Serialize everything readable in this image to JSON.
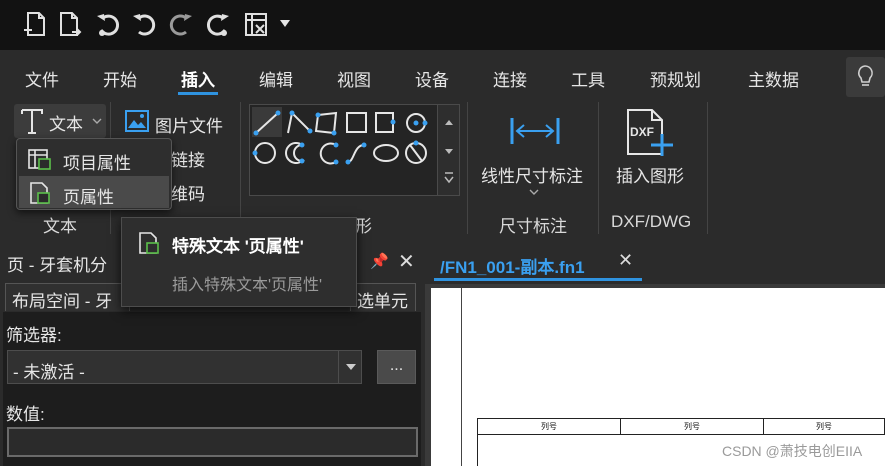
{
  "quick_access": {
    "icons": [
      "new-file-icon",
      "new-file-from-template-icon",
      "undo-history-icon",
      "undo-icon",
      "redo-icon",
      "redo-history-icon",
      "close-project-icon"
    ]
  },
  "ribbon_tabs": [
    "文件",
    "开始",
    "插入",
    "编辑",
    "视图",
    "设备",
    "连接",
    "工具",
    "预规划",
    "主数据"
  ],
  "active_tab": "插入",
  "ribbon": {
    "text_button": "文本",
    "picture_file": "图片文件",
    "hyperlink": "链接",
    "qrcode": "维码",
    "graphics_group_partial": "图形",
    "graphics_group_obscured": "图片",
    "linear_dimension": "线性尺寸标注",
    "insert_graphic": "插入图形",
    "dxf_badge": "DXF",
    "groups": {
      "text": "文本",
      "dimension": "尺寸标注",
      "dxf": "DXF/DWG"
    }
  },
  "text_menu": {
    "items": [
      "项目属性",
      "页属性"
    ]
  },
  "tooltip": {
    "title": "特殊文本 '页属性'",
    "description": "插入特殊文本'页属性'"
  },
  "panel": {
    "title": "页 - 牙套机分",
    "tabs": [
      "布局空间 - 牙",
      "选单元"
    ],
    "filter_label": "筛选器:",
    "filter_value": "- 未激活 -",
    "dots_button": "...",
    "value_label": "数值:"
  },
  "document": {
    "tab_name": "/FN1_001-副本.fn1",
    "title_cells": [
      "列号",
      "列号",
      "列号"
    ]
  },
  "watermark": "CSDN @萧技电创EIIA",
  "colors": {
    "accent": "#2f93e0",
    "icon_blue": "#3aa0f0"
  }
}
